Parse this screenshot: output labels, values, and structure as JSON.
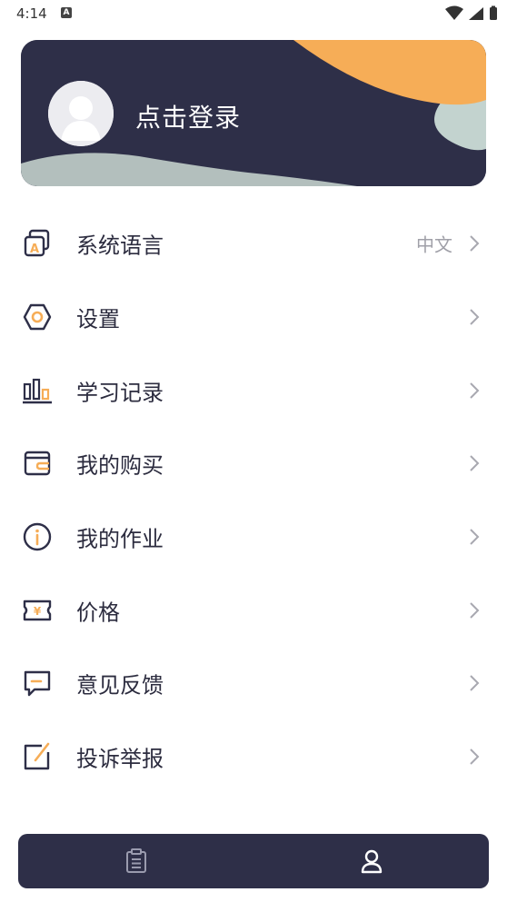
{
  "status_bar": {
    "time": "4:14",
    "notification_icon": "a-icon",
    "right_icons": [
      "wifi-icon",
      "signal-icon",
      "battery-icon"
    ]
  },
  "profile": {
    "login_text": "点击登录",
    "avatar_icon": "avatar-placeholder-icon"
  },
  "menu": {
    "items": [
      {
        "label": "系统语言",
        "value": "中文",
        "icon": "language-icon"
      },
      {
        "label": "设置",
        "value": "",
        "icon": "settings-icon"
      },
      {
        "label": "学习记录",
        "value": "",
        "icon": "study-record-icon"
      },
      {
        "label": "我的购买",
        "value": "",
        "icon": "wallet-icon"
      },
      {
        "label": "我的作业",
        "value": "",
        "icon": "info-icon"
      },
      {
        "label": "价格",
        "value": "",
        "icon": "price-ticket-icon"
      },
      {
        "label": "意见反馈",
        "value": "",
        "icon": "feedback-icon"
      },
      {
        "label": "投诉举报",
        "value": "",
        "icon": "report-icon"
      }
    ]
  },
  "tab_bar": {
    "tabs": [
      {
        "name": "notes",
        "icon": "clipboard-icon",
        "active": false
      },
      {
        "name": "profile",
        "icon": "user-icon",
        "active": true
      }
    ]
  },
  "colors": {
    "dark_navy": "#2e2f48",
    "accent_orange": "#f6ad57",
    "accent_sage": "#c3d3cf",
    "text_primary": "#2c2c3f",
    "text_secondary": "#a0a0a8"
  }
}
